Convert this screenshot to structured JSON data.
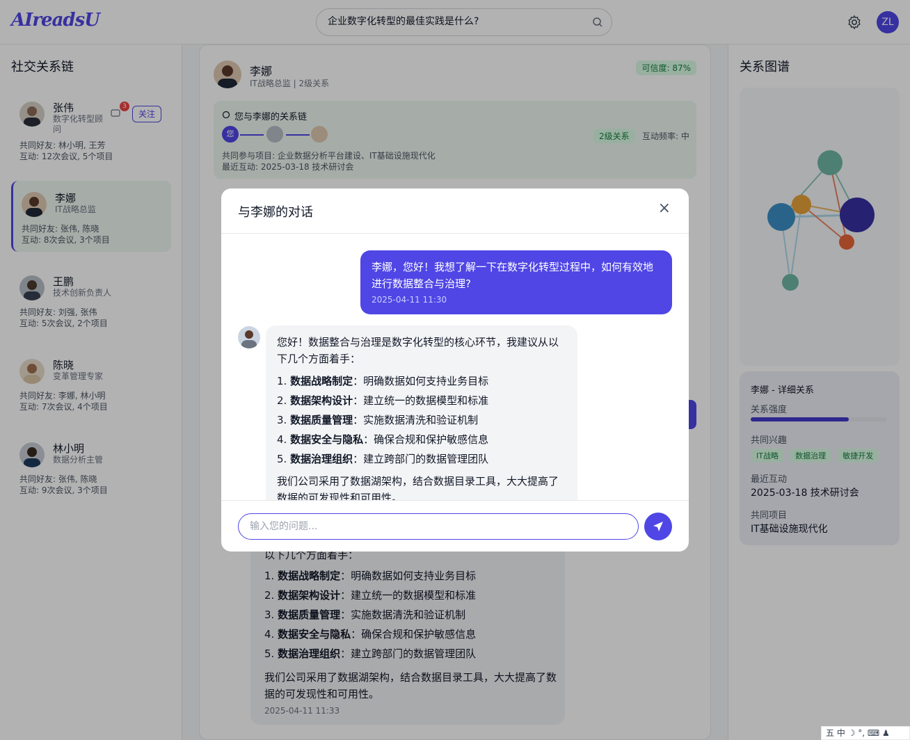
{
  "header": {
    "logo": "AIreadsU",
    "search_value": "企业数字化转型的最佳实践是什么?",
    "avatar": "ZL"
  },
  "left": {
    "title": "社交关系链",
    "contacts": [
      {
        "name": "张伟",
        "role": "数字化转型顾问",
        "friends": "共同好友: 林小明, 王芳",
        "interactions": "互动: 12次会议, 5个项目",
        "badge": "3",
        "follow": "关注"
      },
      {
        "name": "李娜",
        "role": "IT战略总监",
        "friends": "共同好友: 张伟, 陈晓",
        "interactions": "互动: 8次会议, 3个项目"
      },
      {
        "name": "王鹏",
        "role": "技术创新负责人",
        "friends": "共同好友: 刘强, 张伟",
        "interactions": "互动: 5次会议, 2个项目"
      },
      {
        "name": "陈晓",
        "role": "变革管理专家",
        "friends": "共同好友: 李娜, 林小明",
        "interactions": "互动: 7次会议, 4个项目"
      },
      {
        "name": "林小明",
        "role": "数据分析主管",
        "friends": "共同好友: 张伟, 陈晓",
        "interactions": "互动: 9次会议, 3个项目"
      }
    ]
  },
  "center": {
    "name": "李娜",
    "sub": "IT战略总监 | 2级关系",
    "trust": "可信度: 87%",
    "chain_title": "您与李娜的关系链",
    "chain_you": "您",
    "chain_level": "2级关系",
    "chain_freq": "互动频率: 中",
    "projects": "共同参与项目: 企业数据分析平台建设、IT基础设施现代化",
    "last": "最近互动: 2025-03-18 技术研讨会"
  },
  "right": {
    "title": "关系图谱",
    "detail_title": "李娜 - 详细关系",
    "strength_label": "关系强度",
    "strength_value": 0.72,
    "interest_label": "共同兴趣",
    "interests": [
      "IT战略",
      "数据治理",
      "敏捷开发"
    ],
    "recent_label": "最近互动",
    "recent_value": "2025-03-18 技术研讨会",
    "project_label": "共同项目",
    "project_value": "IT基础设施现代化",
    "node_colors": [
      "#6fb8a4",
      "#e8a33a",
      "#3b8fc4",
      "#3730a3",
      "#e8653a",
      "#6fb8a4"
    ]
  },
  "modal": {
    "title": "与李娜的对话",
    "close": "×",
    "user_msg": "李娜，您好！我想了解一下在数字化转型过程中，如何有效地进行数据整合与治理?",
    "user_time": "2025-04-11 11:30",
    "bot_intro": "您好！数据整合与治理是数字化转型的核心环节，我建议从以下几个方面着手：",
    "bot_items": [
      {
        "n": "1. ",
        "b": "数据战略制定",
        "t": "：明确数据如何支持业务目标"
      },
      {
        "n": "2. ",
        "b": "数据架构设计",
        "t": "：建立统一的数据模型和标准"
      },
      {
        "n": "3. ",
        "b": "数据质量管理",
        "t": "：实施数据清洗和验证机制"
      },
      {
        "n": "4. ",
        "b": "数据安全与隐私",
        "t": "：确保合规和保护敏感信息"
      },
      {
        "n": "5. ",
        "b": "数据治理组织",
        "t": "：建立跨部门的数据管理团队"
      }
    ],
    "bot_outro": "我们公司采用了数据湖架构，结合数据目录工具，大大提高了数据的可发现性和可用性。",
    "bot_time": "2025-04-11 11:33",
    "input_placeholder": "输入您的问题..."
  },
  "tray": "五 中 ☽ °, ⌨ ♟"
}
